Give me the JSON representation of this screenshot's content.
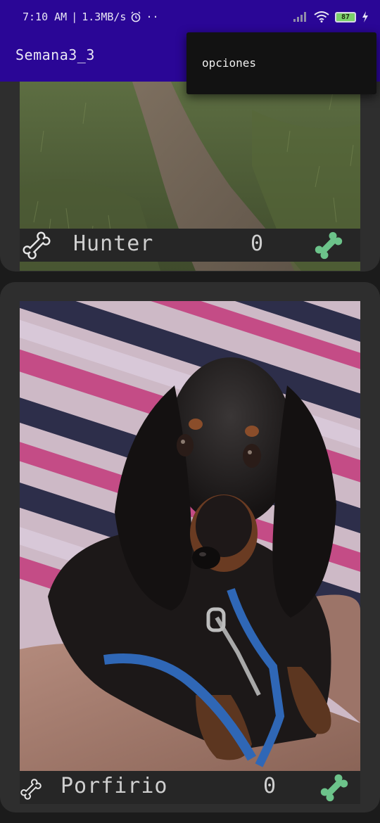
{
  "status_bar": {
    "time": "7:10 AM",
    "separator": "|",
    "speed": "1.3MB/s",
    "battery": "87"
  },
  "app_bar": {
    "title": "Semana3_3"
  },
  "menu": {
    "items": [
      {
        "label": "opciones"
      }
    ]
  },
  "pets": [
    {
      "name": "Hunter",
      "likes": "0"
    },
    {
      "name": "Porfirio",
      "likes": "0"
    }
  ],
  "colors": {
    "app_bar": "#2a0696",
    "card": "#2e2e2e",
    "background": "#1b1b1b",
    "bone_filled": "#6cc38a",
    "bone_outline": "#e6e6e6"
  }
}
